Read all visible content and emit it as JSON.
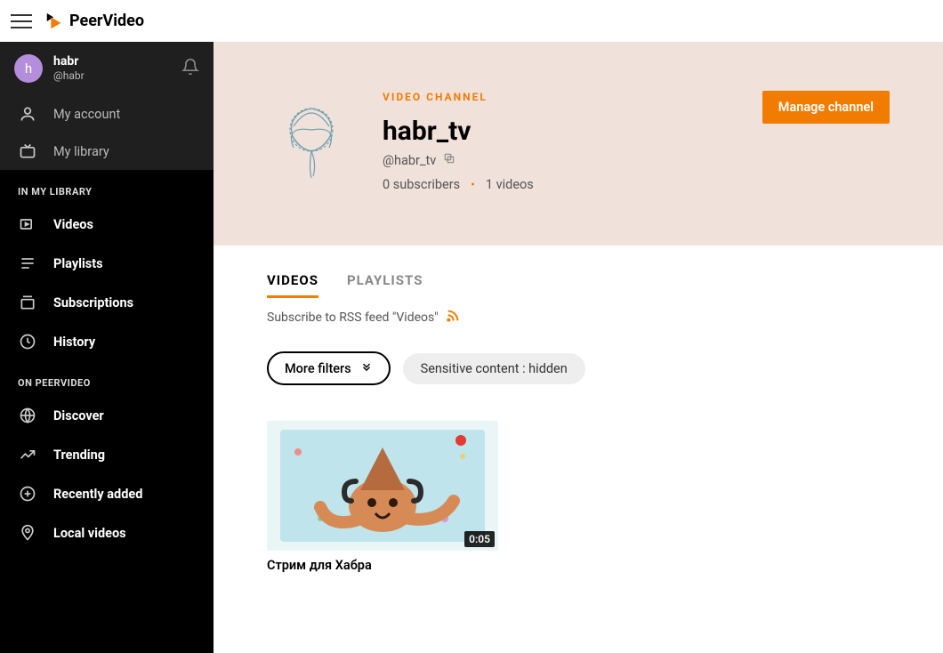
{
  "brand": {
    "name": "PeerVideo"
  },
  "user": {
    "display_name": "habr",
    "handle": "@habr",
    "avatar_letter": "h"
  },
  "account_links": {
    "my_account": "My account",
    "my_library": "My library"
  },
  "sidebar": {
    "library_title": "IN MY LIBRARY",
    "library_items": [
      {
        "label": "Videos"
      },
      {
        "label": "Playlists"
      },
      {
        "label": "Subscriptions"
      },
      {
        "label": "History"
      }
    ],
    "platform_title": "ON PEERVIDEO",
    "platform_items": [
      {
        "label": "Discover"
      },
      {
        "label": "Trending"
      },
      {
        "label": "Recently added"
      },
      {
        "label": "Local videos"
      }
    ]
  },
  "channel": {
    "eyebrow": "VIDEO CHANNEL",
    "title": "habr_tv",
    "handle": "@habr_tv",
    "subscribers": "0 subscribers",
    "video_count": "1 videos",
    "manage_label": "Manage channel"
  },
  "tabs": {
    "videos": "VIDEOS",
    "playlists": "PLAYLISTS"
  },
  "rss_text": "Subscribe to RSS feed \"Videos\"",
  "filters": {
    "more": "More filters",
    "sensitive": "Sensitive content : hidden"
  },
  "videos": [
    {
      "title": "Стрим для Хабра",
      "duration": "0:05"
    }
  ]
}
